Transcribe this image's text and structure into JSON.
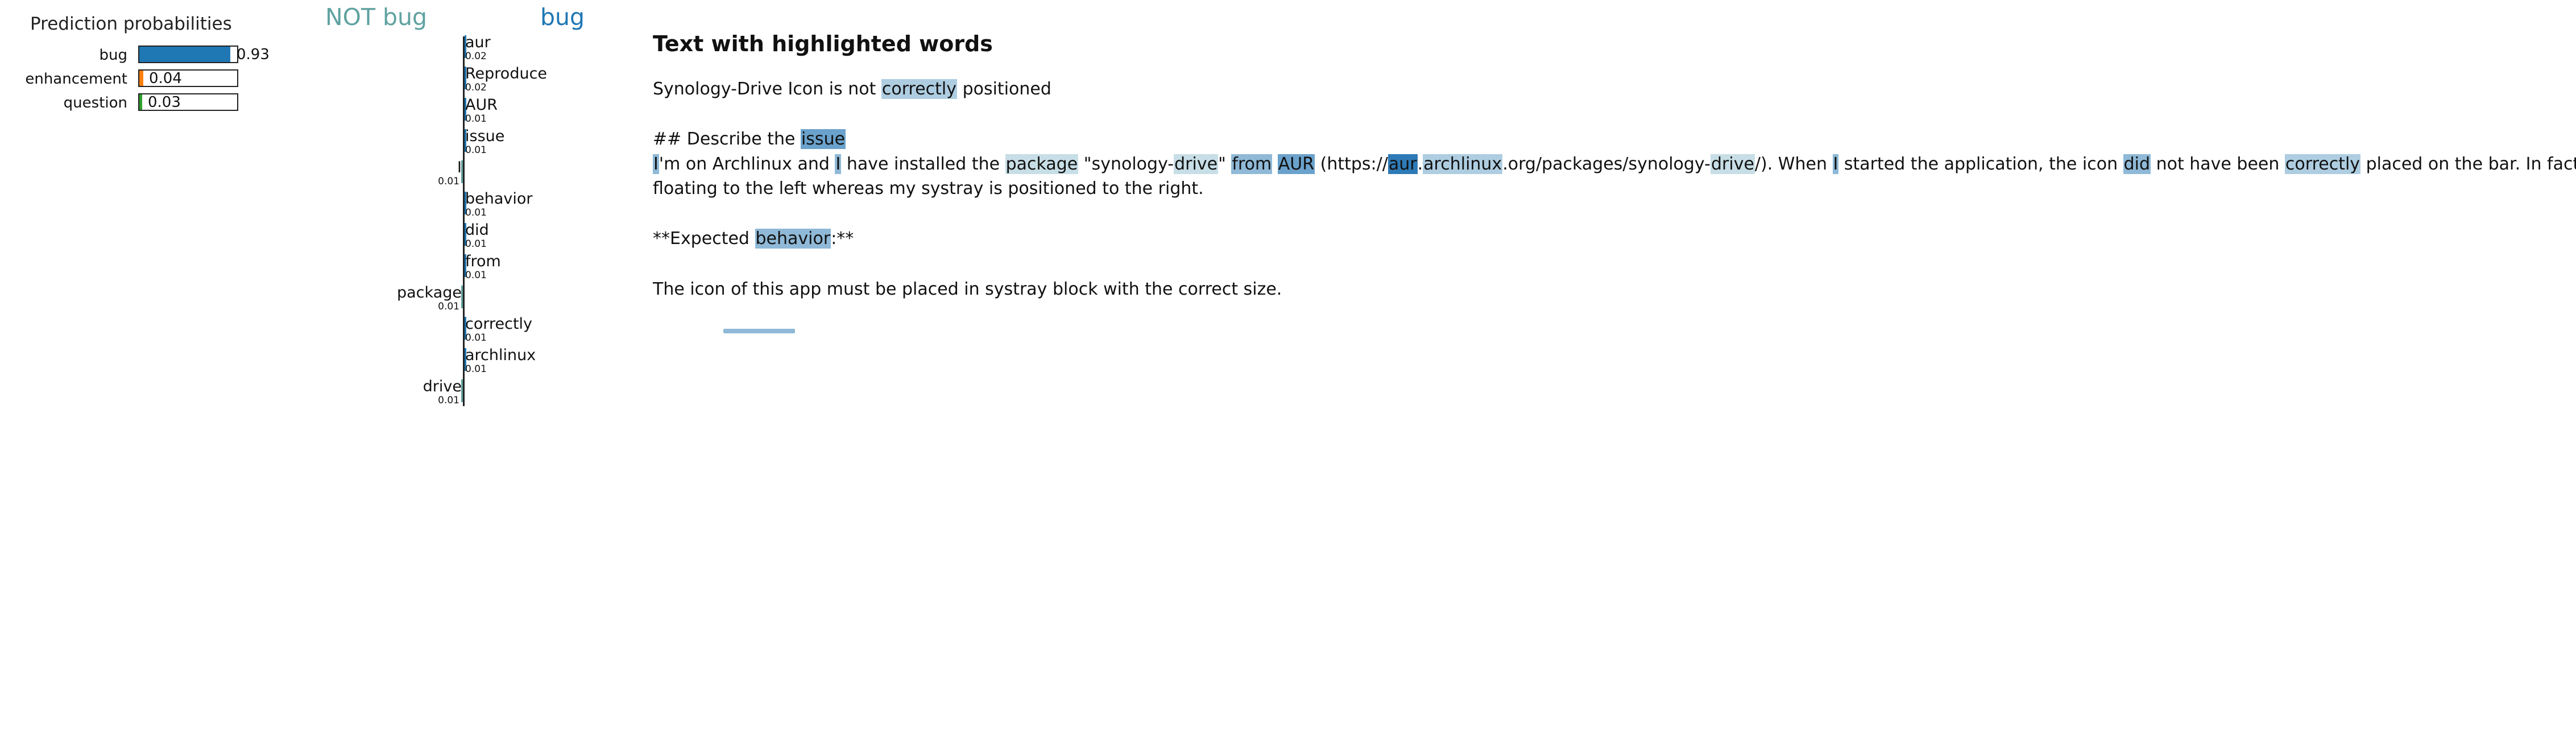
{
  "prediction": {
    "title": "Prediction probabilities",
    "rows": [
      {
        "label": "bug",
        "value": 0.93,
        "value_text": "0.93",
        "color": "#1f77b4"
      },
      {
        "label": "enhancement",
        "value": 0.04,
        "value_text": "0.04",
        "color": "#ff7f0e"
      },
      {
        "label": "question",
        "value": 0.03,
        "value_text": "0.03",
        "color": "#2ca02c"
      }
    ]
  },
  "weights": {
    "neg_label": "NOT bug",
    "pos_label": "bug",
    "neg_color": "#5fa2a0",
    "pos_color": "#1f77b4",
    "features": [
      {
        "word": "aur",
        "weight_text": "0.02",
        "weight": 0.02,
        "side": "pos"
      },
      {
        "word": "Reproduce",
        "weight_text": "0.02",
        "weight": 0.02,
        "side": "pos"
      },
      {
        "word": "AUR",
        "weight_text": "0.01",
        "weight": 0.01,
        "side": "pos"
      },
      {
        "word": "issue",
        "weight_text": "0.01",
        "weight": 0.01,
        "side": "pos"
      },
      {
        "word": "I",
        "weight_text": "0.01",
        "weight": 0.01,
        "side": "neg"
      },
      {
        "word": "behavior",
        "weight_text": "0.01",
        "weight": 0.01,
        "side": "pos"
      },
      {
        "word": "did",
        "weight_text": "0.01",
        "weight": 0.01,
        "side": "pos"
      },
      {
        "word": "from",
        "weight_text": "0.01",
        "weight": 0.01,
        "side": "pos"
      },
      {
        "word": "package",
        "weight_text": "0.01",
        "weight": 0.01,
        "side": "neg"
      },
      {
        "word": "correctly",
        "weight_text": "0.01",
        "weight": 0.01,
        "side": "pos"
      },
      {
        "word": "archlinux",
        "weight_text": "0.01",
        "weight": 0.01,
        "side": "pos"
      },
      {
        "word": "drive",
        "weight_text": "0.01",
        "weight": 0.01,
        "side": "neg"
      }
    ]
  },
  "text": {
    "title": "Text with highlighted words",
    "lines": [
      {
        "segments": [
          [
            "Synology-Drive Icon is not ",
            0
          ],
          [
            "correctly",
            2
          ],
          [
            " positioned",
            0
          ]
        ]
      },
      {
        "segments": [
          [
            "## Describe the ",
            0
          ],
          [
            "issue",
            4
          ]
        ]
      },
      {
        "segments": [
          [
            "I",
            3
          ],
          [
            "'m on Archlinux and ",
            0
          ],
          [
            "I",
            3
          ],
          [
            " have installed the ",
            0
          ],
          [
            "package",
            1
          ],
          [
            " \"synology-",
            0
          ],
          [
            "drive",
            1
          ],
          [
            "\" ",
            0
          ],
          [
            "from",
            3
          ],
          [
            " ",
            0
          ],
          [
            "AUR",
            4
          ],
          [
            " (https://",
            0
          ],
          [
            "aur",
            5
          ],
          [
            ".",
            0
          ],
          [
            "archlinux",
            2
          ],
          [
            ".org/packages/synology-",
            0
          ],
          [
            "drive",
            1
          ],
          [
            "/). When ",
            0
          ],
          [
            "I",
            3
          ],
          [
            " started the application, the icon ",
            0
          ],
          [
            "did",
            3
          ],
          [
            " not have been ",
            0
          ],
          [
            "correctly",
            2
          ],
          [
            " placed on the bar. In fact, the icon",
            0
          ]
        ]
      },
      {
        "segments": [
          [
            "floating to the left whereas my systray is positioned to the right.",
            0
          ]
        ]
      },
      {
        "segments": [
          [
            "**Expected ",
            0
          ],
          [
            "behavior",
            3
          ],
          [
            ":**",
            0
          ]
        ]
      },
      {
        "segments": [
          [
            "The icon of this app must be placed in systray block with the correct size.",
            0
          ]
        ]
      }
    ]
  }
}
